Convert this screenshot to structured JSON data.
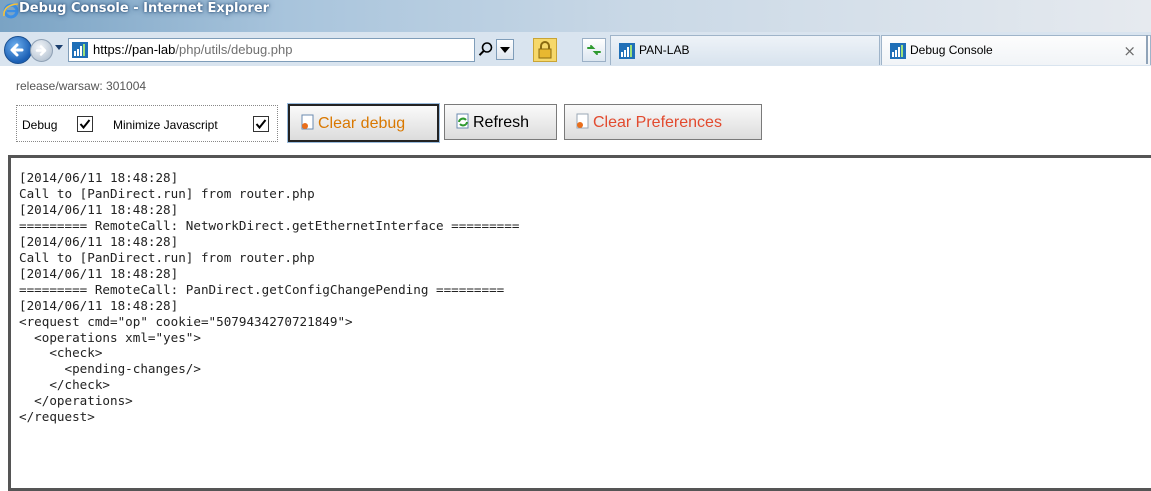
{
  "window": {
    "title": "Debug Console - Internet Explorer"
  },
  "navbar": {
    "url_host": "https://pan-lab",
    "url_rest": "/php/utils/debug.php",
    "back_icon": "back-arrow-icon",
    "forward_icon": "forward-arrow-icon",
    "search_icon": "magnifier-icon",
    "lock_icon": "padlock-icon",
    "compat_icon": "compatibility-view-icon"
  },
  "tabs": [
    {
      "label": "PAN-LAB",
      "icon": "pan-favicon",
      "active": false
    },
    {
      "label": "Debug Console",
      "icon": "pan-favicon",
      "active": true,
      "close": "×"
    }
  ],
  "page": {
    "release": "release/warsaw: 301004",
    "debug_label": "Debug",
    "debug_checked": true,
    "minimize_label": "Minimize Javascript",
    "minimize_checked": true,
    "buttons": {
      "clear_debug": "Clear debug",
      "refresh": "Refresh",
      "clear_preferences": "Clear Preferences"
    }
  },
  "console": {
    "text": "[2014/06/11 18:48:28]\nCall to [PanDirect.run] from router.php\n[2014/06/11 18:48:28]\n========= RemoteCall: NetworkDirect.getEthernetInterface =========\n[2014/06/11 18:48:28]\nCall to [PanDirect.run] from router.php\n[2014/06/11 18:48:28]\n========= RemoteCall: PanDirect.getConfigChangePending =========\n[2014/06/11 18:48:28]\n<request cmd=\"op\" cookie=\"5079434270721849\">\n  <operations xml=\"yes\">\n    <check>\n      <pending-changes/>\n    </check>\n  </operations>\n</request>"
  },
  "colors": {
    "clear_debug_text": "#d97800",
    "clear_prefs_text": "#e24a2e",
    "titlebar_start": "#7aa3c4"
  }
}
